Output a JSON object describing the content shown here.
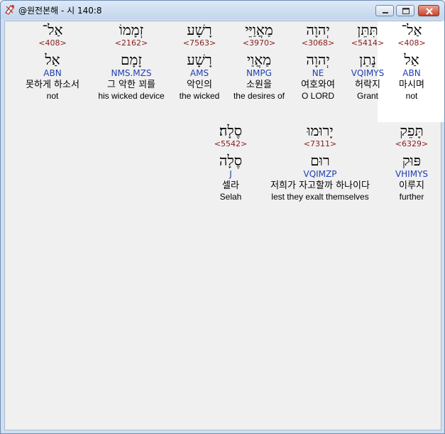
{
  "window": {
    "title": "@원전본해 - 시 140:8",
    "icon": "bible-app-icon"
  },
  "rows": [
    {
      "words": [
        {
          "surface": "אַל־",
          "strong": "<408>",
          "lemma": "אַל",
          "parse": "ABN",
          "korean": "마시며",
          "english": "not",
          "selected": true
        },
        {
          "surface": "תִּתֵּן",
          "strong": "<5414>",
          "lemma": "נָתַן",
          "parse": "VQIMYS",
          "korean": "허락지",
          "english": "Grant",
          "selected": false
        },
        {
          "surface": "יְהוָה",
          "strong": "<3068>",
          "lemma": "יְהוָה",
          "parse": "NE",
          "korean": "여호와여",
          "english": "O LORD",
          "selected": false
        },
        {
          "surface": "מַאֲוַיֵּי",
          "strong": "<3970>",
          "lemma": "מַאֲוַי",
          "parse": "NMPG",
          "korean": "소원을",
          "english": "the desires of",
          "selected": false
        },
        {
          "surface": "רָשָׁע",
          "strong": "<7563>",
          "lemma": "רָשָׁע",
          "parse": "AMS",
          "korean": "악인의",
          "english": "the wicked",
          "selected": false
        },
        {
          "surface": "זְמָמוֹ",
          "strong": "<2162>",
          "lemma": "זָמָם",
          "parse": "NMS.MZS",
          "korean": "그 악한 꾀를",
          "english": "his wicked device",
          "selected": false
        },
        {
          "surface": "אַל־",
          "strong": "<408>",
          "lemma": "אַל",
          "parse": "ABN",
          "korean": "못하게 하소서",
          "english": "not",
          "selected": false
        }
      ]
    },
    {
      "words": [
        {
          "surface": "תָּפֵק",
          "strong": "<6329>",
          "lemma": "פּוּק",
          "parse": "VHIMYS",
          "korean": "이루지",
          "english": "further",
          "selected": false
        },
        {
          "surface": "יָרוּמוּ",
          "strong": "<7311>",
          "lemma": "רוּם",
          "parse": "VQIMZP",
          "korean": "저희가 자고할까 하나이다",
          "english": "lest they exalt themselves",
          "selected": false
        },
        {
          "surface": "סֶלָה׃",
          "strong": "<5542>",
          "lemma": "סֶלָה",
          "parse": "J",
          "korean": "셀라",
          "english": "Selah",
          "selected": false
        }
      ]
    }
  ]
}
